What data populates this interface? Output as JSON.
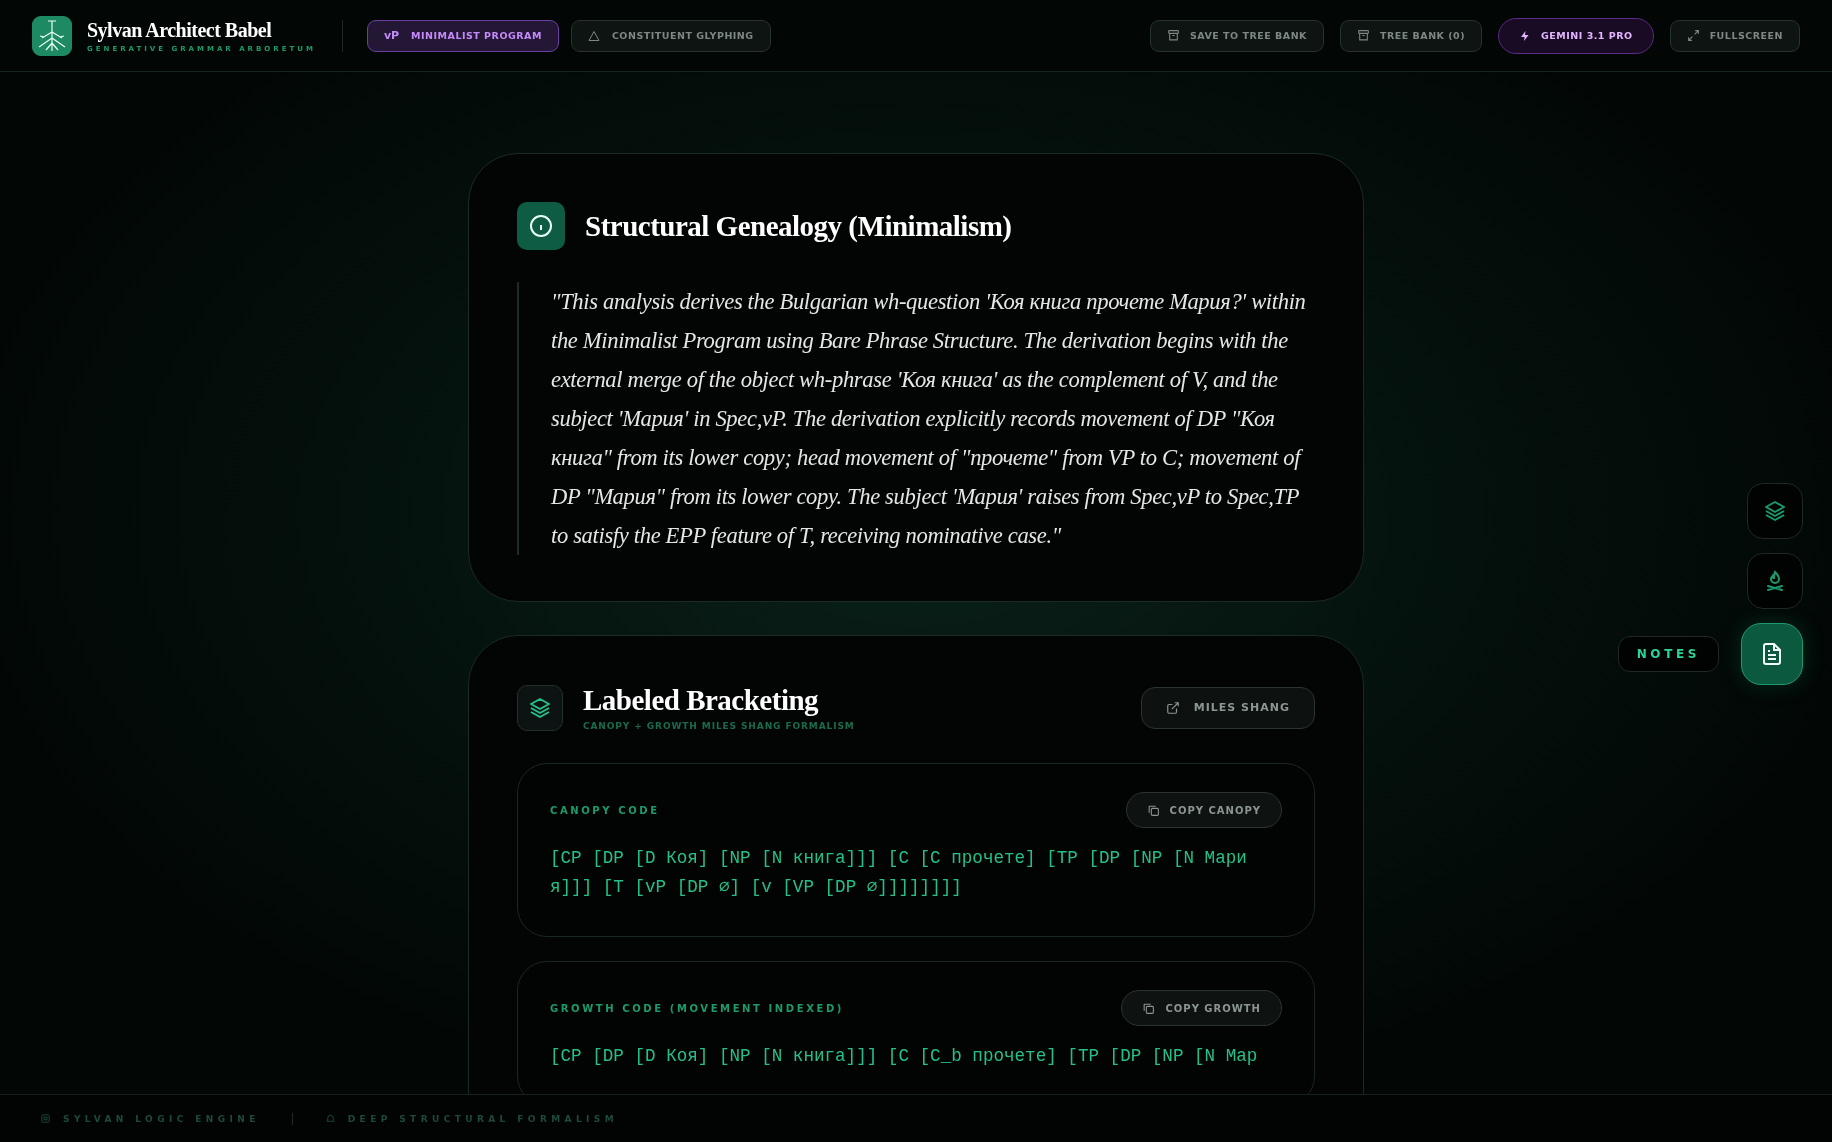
{
  "header": {
    "title": "Sylvan Architect Babel",
    "subtitle": "GENERATIVE GRAMMAR ARBORETUM",
    "modes": [
      {
        "badge": "vP",
        "label": "MINIMALIST PROGRAM",
        "selected": true
      },
      {
        "label": "CONSTITUENT GLYPHING",
        "selected": false
      }
    ],
    "actions": [
      {
        "kind": "save",
        "label": "SAVE TO TREE BANK"
      },
      {
        "kind": "bank",
        "label": "TREE BANK (0)"
      },
      {
        "kind": "model",
        "label": "GEMINI 3.1 PRO"
      },
      {
        "kind": "fullscreen",
        "label": "FULLSCREEN"
      }
    ]
  },
  "genealogy": {
    "title": "Structural Genealogy (Minimalism)",
    "quote": "\"This analysis derives the Bulgarian wh-question 'Коя книга прочете Мария?' within the Minimalist Program using Bare Phrase Structure. The derivation begins with the external merge of the object wh-phrase 'Коя книга' as the complement of V, and the subject 'Мария' in Spec,vP. The derivation explicitly records movement of DP \"Коя книга\" from its lower copy; head movement of \"прочете\" from VP to C; movement of DP \"Мария\" from its lower copy. The subject 'Мария' raises from Spec,vP to Spec,TP to satisfy the EPP feature of T, receiving nominative case.\""
  },
  "bracketing": {
    "title": "Labeled Bracketing",
    "subtitle": "CANOPY + GROWTH MILES SHANG FORMALISM",
    "link": "MILES SHANG",
    "blocks": [
      {
        "label": "CANOPY CODE",
        "button": "COPY CANOPY",
        "code": "[CP [DP [D Коя] [NP [N книга]]] [C [C прочете] [TP [DP [NP [N Мария]]] [T [vP [DP ⌀] [v [VP [DP ⌀]]]]]]]]"
      },
      {
        "label": "GROWTH CODE (MOVEMENT INDEXED)",
        "button": "COPY GROWTH",
        "code": "[CP [DP [D Коя] [NP [N книга]]] [C [C_b прочете] [TP [DP [NP [N Мар"
      }
    ]
  },
  "dock": [
    {
      "kind": "layers",
      "selected": false
    },
    {
      "kind": "campfire",
      "selected": false
    },
    {
      "kind": "notes",
      "selected": true,
      "tooltip": "NOTES"
    }
  ],
  "footer": {
    "items": [
      {
        "kind": "engine",
        "label": "SYLVAN LOGIC ENGINE"
      },
      {
        "kind": "formalism",
        "label": "DEEP STRUCTURAL FORMALISM"
      }
    ]
  }
}
